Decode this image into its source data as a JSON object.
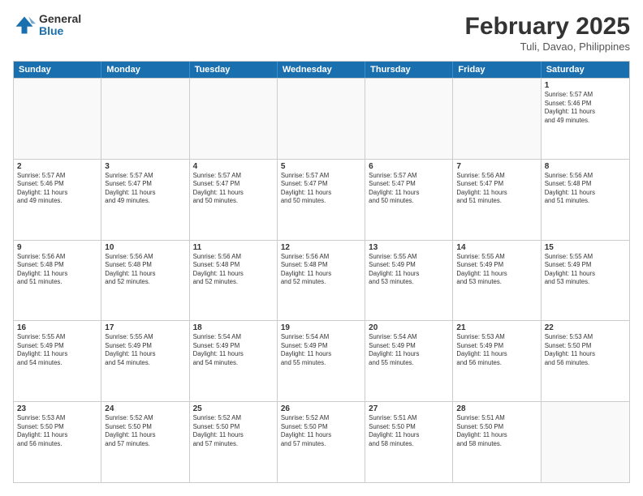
{
  "logo": {
    "general": "General",
    "blue": "Blue"
  },
  "title": "February 2025",
  "location": "Tuli, Davao, Philippines",
  "days_of_week": [
    "Sunday",
    "Monday",
    "Tuesday",
    "Wednesday",
    "Thursday",
    "Friday",
    "Saturday"
  ],
  "weeks": [
    [
      {
        "day": "",
        "info": ""
      },
      {
        "day": "",
        "info": ""
      },
      {
        "day": "",
        "info": ""
      },
      {
        "day": "",
        "info": ""
      },
      {
        "day": "",
        "info": ""
      },
      {
        "day": "",
        "info": ""
      },
      {
        "day": "1",
        "info": "Sunrise: 5:57 AM\nSunset: 5:46 PM\nDaylight: 11 hours\nand 49 minutes."
      }
    ],
    [
      {
        "day": "2",
        "info": "Sunrise: 5:57 AM\nSunset: 5:46 PM\nDaylight: 11 hours\nand 49 minutes."
      },
      {
        "day": "3",
        "info": "Sunrise: 5:57 AM\nSunset: 5:47 PM\nDaylight: 11 hours\nand 49 minutes."
      },
      {
        "day": "4",
        "info": "Sunrise: 5:57 AM\nSunset: 5:47 PM\nDaylight: 11 hours\nand 50 minutes."
      },
      {
        "day": "5",
        "info": "Sunrise: 5:57 AM\nSunset: 5:47 PM\nDaylight: 11 hours\nand 50 minutes."
      },
      {
        "day": "6",
        "info": "Sunrise: 5:57 AM\nSunset: 5:47 PM\nDaylight: 11 hours\nand 50 minutes."
      },
      {
        "day": "7",
        "info": "Sunrise: 5:56 AM\nSunset: 5:47 PM\nDaylight: 11 hours\nand 51 minutes."
      },
      {
        "day": "8",
        "info": "Sunrise: 5:56 AM\nSunset: 5:48 PM\nDaylight: 11 hours\nand 51 minutes."
      }
    ],
    [
      {
        "day": "9",
        "info": "Sunrise: 5:56 AM\nSunset: 5:48 PM\nDaylight: 11 hours\nand 51 minutes."
      },
      {
        "day": "10",
        "info": "Sunrise: 5:56 AM\nSunset: 5:48 PM\nDaylight: 11 hours\nand 52 minutes."
      },
      {
        "day": "11",
        "info": "Sunrise: 5:56 AM\nSunset: 5:48 PM\nDaylight: 11 hours\nand 52 minutes."
      },
      {
        "day": "12",
        "info": "Sunrise: 5:56 AM\nSunset: 5:48 PM\nDaylight: 11 hours\nand 52 minutes."
      },
      {
        "day": "13",
        "info": "Sunrise: 5:55 AM\nSunset: 5:49 PM\nDaylight: 11 hours\nand 53 minutes."
      },
      {
        "day": "14",
        "info": "Sunrise: 5:55 AM\nSunset: 5:49 PM\nDaylight: 11 hours\nand 53 minutes."
      },
      {
        "day": "15",
        "info": "Sunrise: 5:55 AM\nSunset: 5:49 PM\nDaylight: 11 hours\nand 53 minutes."
      }
    ],
    [
      {
        "day": "16",
        "info": "Sunrise: 5:55 AM\nSunset: 5:49 PM\nDaylight: 11 hours\nand 54 minutes."
      },
      {
        "day": "17",
        "info": "Sunrise: 5:55 AM\nSunset: 5:49 PM\nDaylight: 11 hours\nand 54 minutes."
      },
      {
        "day": "18",
        "info": "Sunrise: 5:54 AM\nSunset: 5:49 PM\nDaylight: 11 hours\nand 54 minutes."
      },
      {
        "day": "19",
        "info": "Sunrise: 5:54 AM\nSunset: 5:49 PM\nDaylight: 11 hours\nand 55 minutes."
      },
      {
        "day": "20",
        "info": "Sunrise: 5:54 AM\nSunset: 5:49 PM\nDaylight: 11 hours\nand 55 minutes."
      },
      {
        "day": "21",
        "info": "Sunrise: 5:53 AM\nSunset: 5:49 PM\nDaylight: 11 hours\nand 56 minutes."
      },
      {
        "day": "22",
        "info": "Sunrise: 5:53 AM\nSunset: 5:50 PM\nDaylight: 11 hours\nand 56 minutes."
      }
    ],
    [
      {
        "day": "23",
        "info": "Sunrise: 5:53 AM\nSunset: 5:50 PM\nDaylight: 11 hours\nand 56 minutes."
      },
      {
        "day": "24",
        "info": "Sunrise: 5:52 AM\nSunset: 5:50 PM\nDaylight: 11 hours\nand 57 minutes."
      },
      {
        "day": "25",
        "info": "Sunrise: 5:52 AM\nSunset: 5:50 PM\nDaylight: 11 hours\nand 57 minutes."
      },
      {
        "day": "26",
        "info": "Sunrise: 5:52 AM\nSunset: 5:50 PM\nDaylight: 11 hours\nand 57 minutes."
      },
      {
        "day": "27",
        "info": "Sunrise: 5:51 AM\nSunset: 5:50 PM\nDaylight: 11 hours\nand 58 minutes."
      },
      {
        "day": "28",
        "info": "Sunrise: 5:51 AM\nSunset: 5:50 PM\nDaylight: 11 hours\nand 58 minutes."
      },
      {
        "day": "",
        "info": ""
      }
    ]
  ]
}
